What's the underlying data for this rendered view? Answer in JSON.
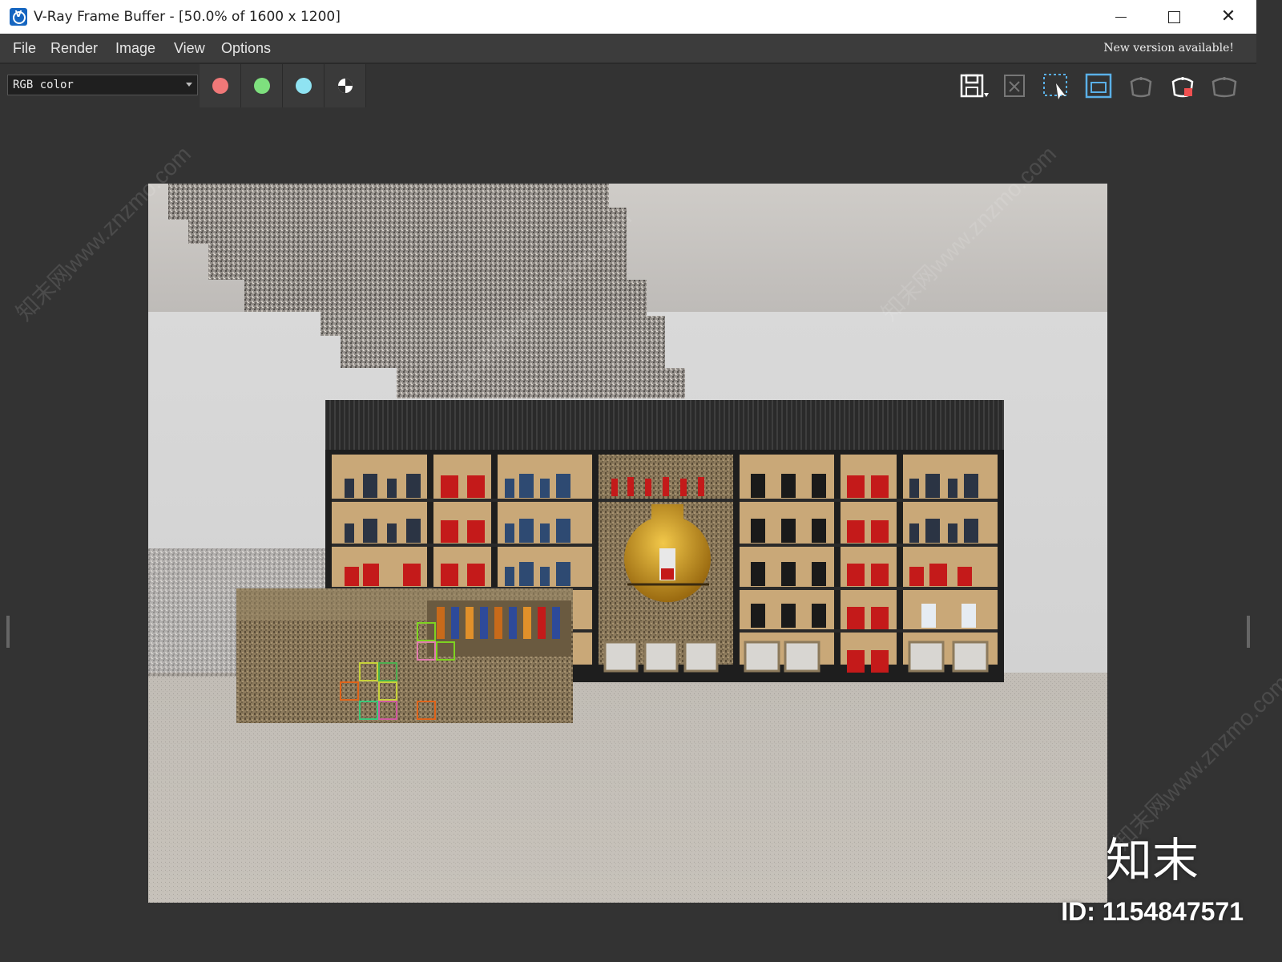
{
  "window": {
    "title": "V-Ray Frame Buffer - [50.0% of 1600 x 1200]",
    "controls": [
      "minimize",
      "maximize",
      "close"
    ]
  },
  "menu": {
    "items": [
      "File",
      "Render",
      "Image",
      "View",
      "Options"
    ],
    "notice": "New version available!"
  },
  "toolbar": {
    "channel": "RGB color",
    "channel_buttons": [
      {
        "name": "red-channel",
        "color": "#f07878"
      },
      {
        "name": "green-channel",
        "color": "#7ee07e"
      },
      {
        "name": "blue-channel",
        "color": "#8fe3f2"
      },
      {
        "name": "alpha-channel",
        "color": "#ffffff"
      }
    ],
    "tools": [
      "save-icon",
      "clear-image-icon",
      "region-select-icon",
      "track-mouse-icon",
      "render-last-icon",
      "render-icon",
      "interactive-render-icon"
    ]
  },
  "watermark": {
    "brand": "知末",
    "id_text": "ID: 1154847571",
    "diagonal": "知末网www.znzmo.com"
  },
  "colors": {
    "background": "#333333",
    "menubar": "#3c3c3c",
    "accent": "#1565c0"
  }
}
